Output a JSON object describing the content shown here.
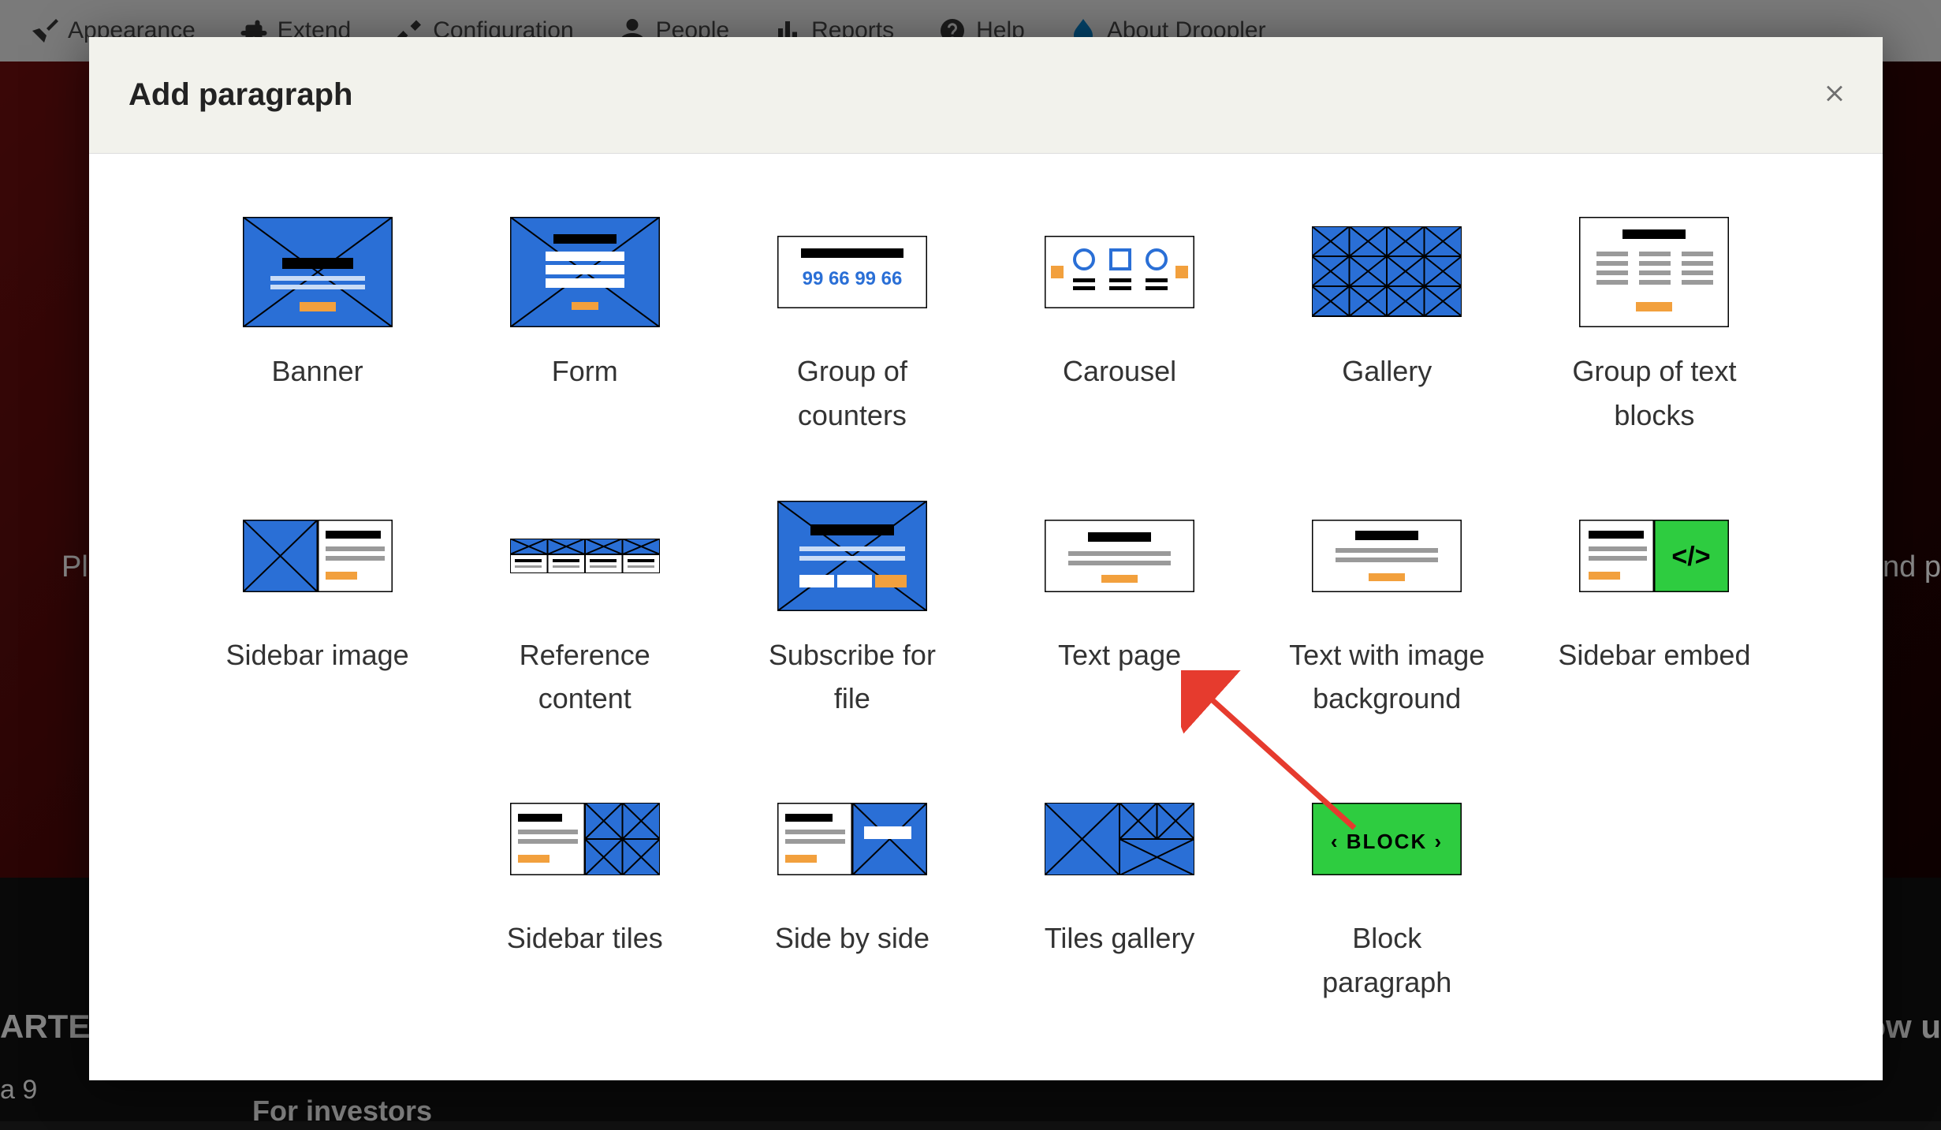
{
  "admin_bar": {
    "items": [
      {
        "label": "Appearance"
      },
      {
        "label": "Extend"
      },
      {
        "label": "Configuration"
      },
      {
        "label": "People"
      },
      {
        "label": "Reports"
      },
      {
        "label": "Help"
      },
      {
        "label": "About Droopler"
      }
    ]
  },
  "hero": {
    "left": "Pl",
    "right": "nd p"
  },
  "footer": {
    "f1": "ARTER",
    "f2": "a 9",
    "f3": "For investors",
    "f4": "ow u"
  },
  "modal": {
    "title": "Add paragraph"
  },
  "paragraphs": [
    {
      "key": "banner",
      "label": "Banner"
    },
    {
      "key": "form",
      "label": "Form"
    },
    {
      "key": "group-of-counters",
      "label": "Group of counters"
    },
    {
      "key": "carousel",
      "label": "Carousel"
    },
    {
      "key": "gallery",
      "label": "Gallery"
    },
    {
      "key": "group-of-text-blocks",
      "label": "Group of text blocks"
    },
    {
      "key": "sidebar-image",
      "label": "Sidebar image"
    },
    {
      "key": "reference-content",
      "label": "Reference content"
    },
    {
      "key": "subscribe-for-file",
      "label": "Subscribe for file"
    },
    {
      "key": "text-page",
      "label": "Text page"
    },
    {
      "key": "text-with-image-background",
      "label": "Text with image background"
    },
    {
      "key": "sidebar-embed",
      "label": "Sidebar embed"
    },
    {
      "key": "empty-13",
      "label": ""
    },
    {
      "key": "sidebar-tiles",
      "label": "Sidebar tiles"
    },
    {
      "key": "side-by-side",
      "label": "Side by side"
    },
    {
      "key": "tiles-gallery",
      "label": "Tiles gallery"
    },
    {
      "key": "block-paragraph",
      "label": "Block paragraph",
      "block_text": "BLOCK"
    },
    {
      "key": "empty-18",
      "label": ""
    }
  ],
  "counters_text": "99 66 99 66"
}
